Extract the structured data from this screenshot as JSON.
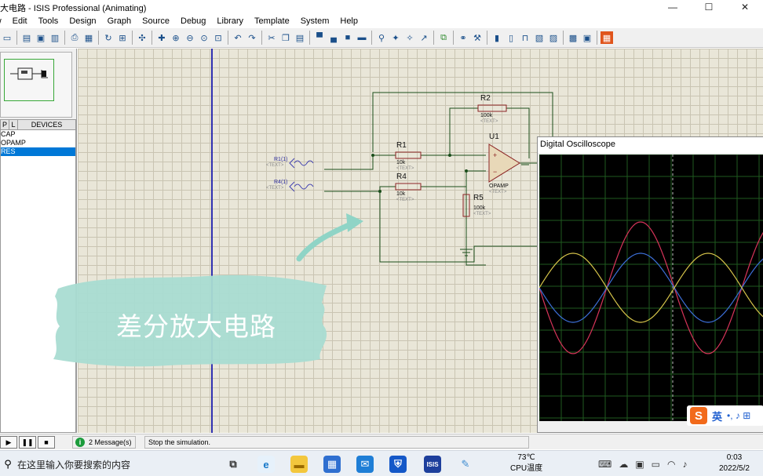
{
  "window": {
    "title": "大电路 - ISIS Professional (Animating)",
    "controls": [
      "—",
      "☐",
      "✕"
    ]
  },
  "menu": [
    "View",
    "Edit",
    "Tools",
    "Design",
    "Graph",
    "Source",
    "Debug",
    "Library",
    "Template",
    "System",
    "Help"
  ],
  "devices_panel": {
    "mode_buttons": [
      "P",
      "L"
    ],
    "header": "DEVICES",
    "items": [
      {
        "label": "CAP",
        "selected": false
      },
      {
        "label": "OPAMP",
        "selected": false
      },
      {
        "label": "RES",
        "selected": true
      }
    ]
  },
  "schematic": {
    "components": [
      {
        "ref": "R1",
        "value": "10k",
        "text": "<TEXT>"
      },
      {
        "ref": "R4",
        "value": "10k",
        "text": "<TEXT>"
      },
      {
        "ref": "R2",
        "value": "100k",
        "text": "<TEXT>"
      },
      {
        "ref": "R5",
        "value": "100k",
        "text": "<TEXT>"
      },
      {
        "ref": "U1",
        "value": "OPAMP",
        "text": "<TEXT>"
      }
    ],
    "sources": [
      {
        "ref": "R1(1)",
        "text": "<TEXT>"
      },
      {
        "ref": "R4(1)",
        "text": "<TEXT>"
      }
    ],
    "overlay_caption": "差分放大电路"
  },
  "oscilloscope": {
    "title": "Digital Oscilloscope",
    "traces_colors": {
      "red": "#d8345a",
      "blue": "#3c6fd8",
      "yellow": "#d6c44a"
    },
    "ime": {
      "lang": "英",
      "extra": "•, ♪ ⊞"
    }
  },
  "status": {
    "sim_buttons": [
      "▶",
      "❚❚",
      "■"
    ],
    "messages": "2 Message(s)",
    "text": "Stop the simulation."
  },
  "taskbar": {
    "search_placeholder": "在这里输入你要搜索的内容",
    "apps": [
      "task-view",
      "edge",
      "explorer",
      "store",
      "mail",
      "defender",
      "isis",
      "proteus-pen"
    ],
    "isis_label": "ISIS",
    "weather": {
      "temp": "73℃",
      "label": "CPU温度"
    },
    "clock": {
      "time": "0:03",
      "date": "2022/5/2"
    }
  }
}
